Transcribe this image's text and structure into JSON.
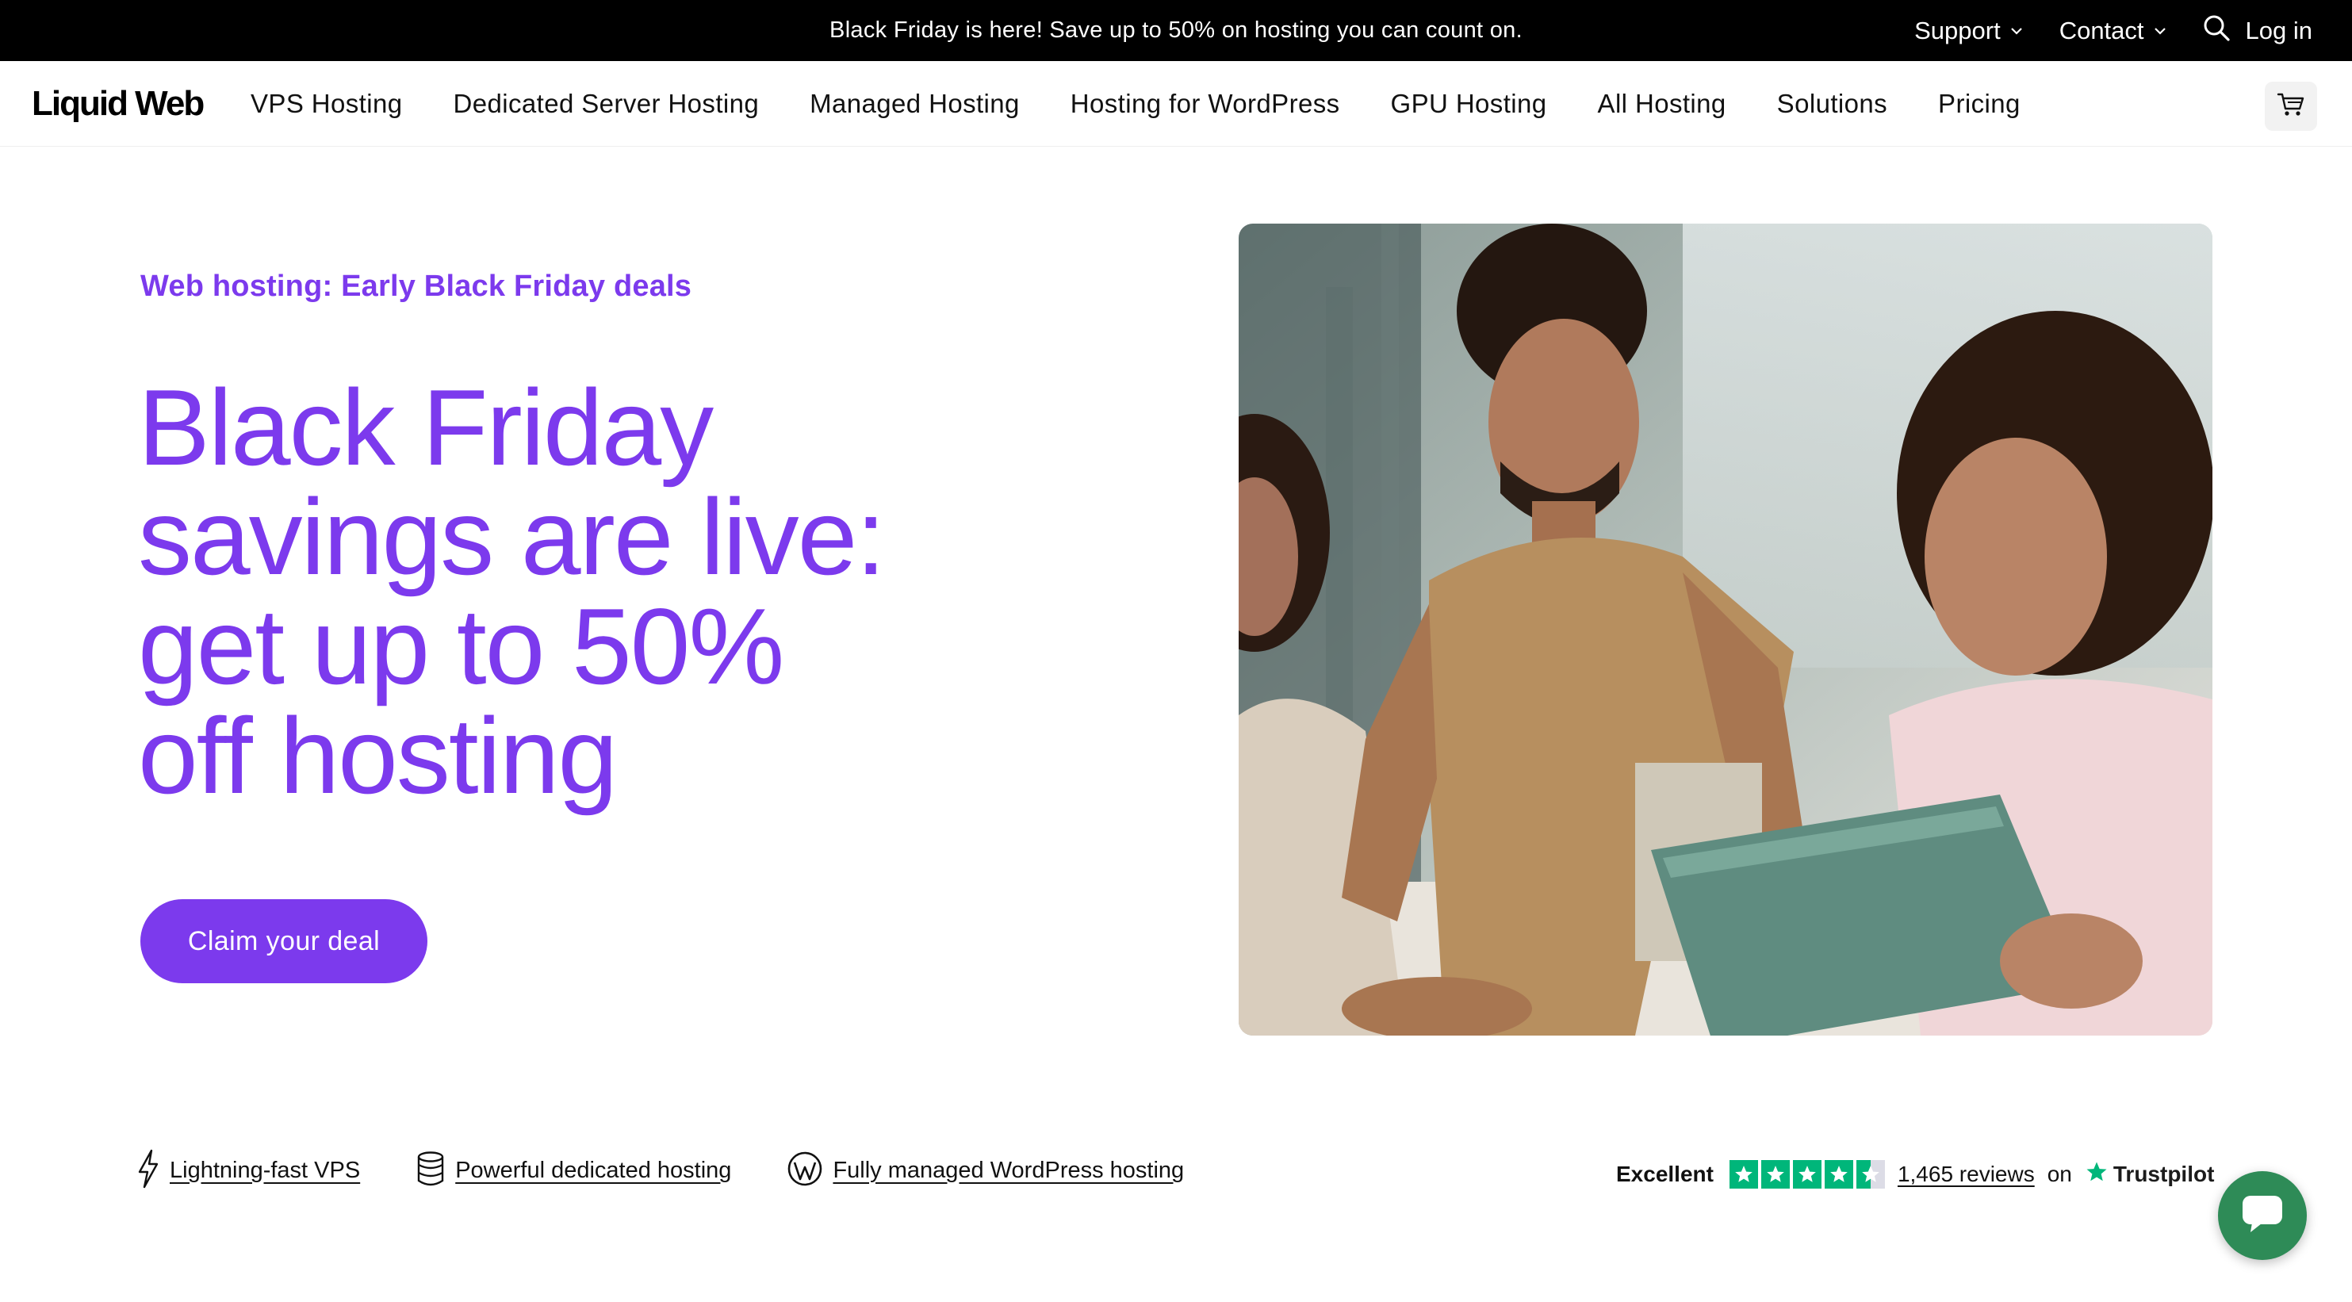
{
  "promo_bar": {
    "message": "Black Friday is here! Save up to 50% on hosting you can count on.",
    "support_label": "Support",
    "contact_label": "Contact",
    "login_label": "Log in"
  },
  "nav": {
    "logo": "Liquid Web",
    "items": [
      {
        "label": "VPS Hosting"
      },
      {
        "label": "Dedicated Server Hosting"
      },
      {
        "label": "Managed Hosting"
      },
      {
        "label": "Hosting for WordPress"
      },
      {
        "label": "GPU Hosting"
      },
      {
        "label": "All Hosting"
      },
      {
        "label": "Solutions"
      },
      {
        "label": "Pricing"
      }
    ]
  },
  "hero": {
    "eyebrow": "Web hosting: Early Black Friday deals",
    "headline_lines": [
      "Black Friday",
      "savings are live:",
      "get up to 50%",
      "off hosting"
    ],
    "cta_label": "Claim your deal"
  },
  "features": [
    {
      "label": "Lightning-fast VPS",
      "icon": "lightning-icon"
    },
    {
      "label": "Powerful dedicated hosting",
      "icon": "database-icon"
    },
    {
      "label": "Fully managed WordPress hosting",
      "icon": "wordpress-icon"
    }
  ],
  "trustpilot": {
    "rating_word": "Excellent",
    "stars": 4.5,
    "reviews": "1,465 reviews",
    "on": "on",
    "brand": "Trustpilot"
  },
  "colors": {
    "accent": "#7c3aed",
    "promo_bg": "#000000",
    "trustpilot_green": "#00b67a",
    "chat_green": "#2e8b57"
  }
}
